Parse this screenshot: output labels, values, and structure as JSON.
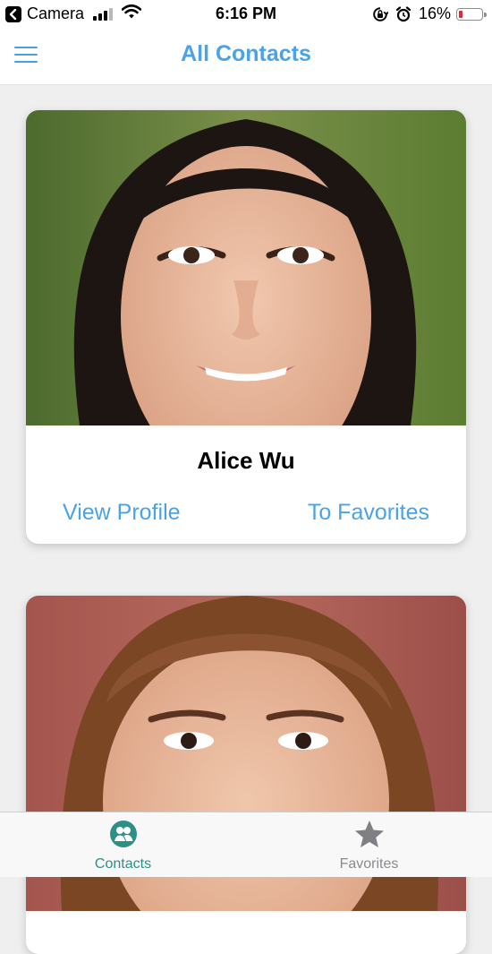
{
  "status_bar": {
    "back_app": "Camera",
    "time": "6:16 PM",
    "battery_percent": "16%",
    "battery_level": 0.16,
    "battery_color": "#e0282d"
  },
  "nav": {
    "title": "All Contacts",
    "menu_icon": "hamburger-menu-icon",
    "accent_color": "#4aa3e8"
  },
  "contacts": [
    {
      "name": "Alice Wu",
      "view_label": "View Profile",
      "favorite_label": "To Favorites"
    },
    {
      "name": "",
      "view_label": "",
      "favorite_label": ""
    }
  ],
  "tabs": [
    {
      "label": "Contacts",
      "icon": "contacts-icon",
      "active": true,
      "color": "#2e8f86"
    },
    {
      "label": "Favorites",
      "icon": "star-icon",
      "active": false,
      "color": "#8a8a8f"
    }
  ]
}
